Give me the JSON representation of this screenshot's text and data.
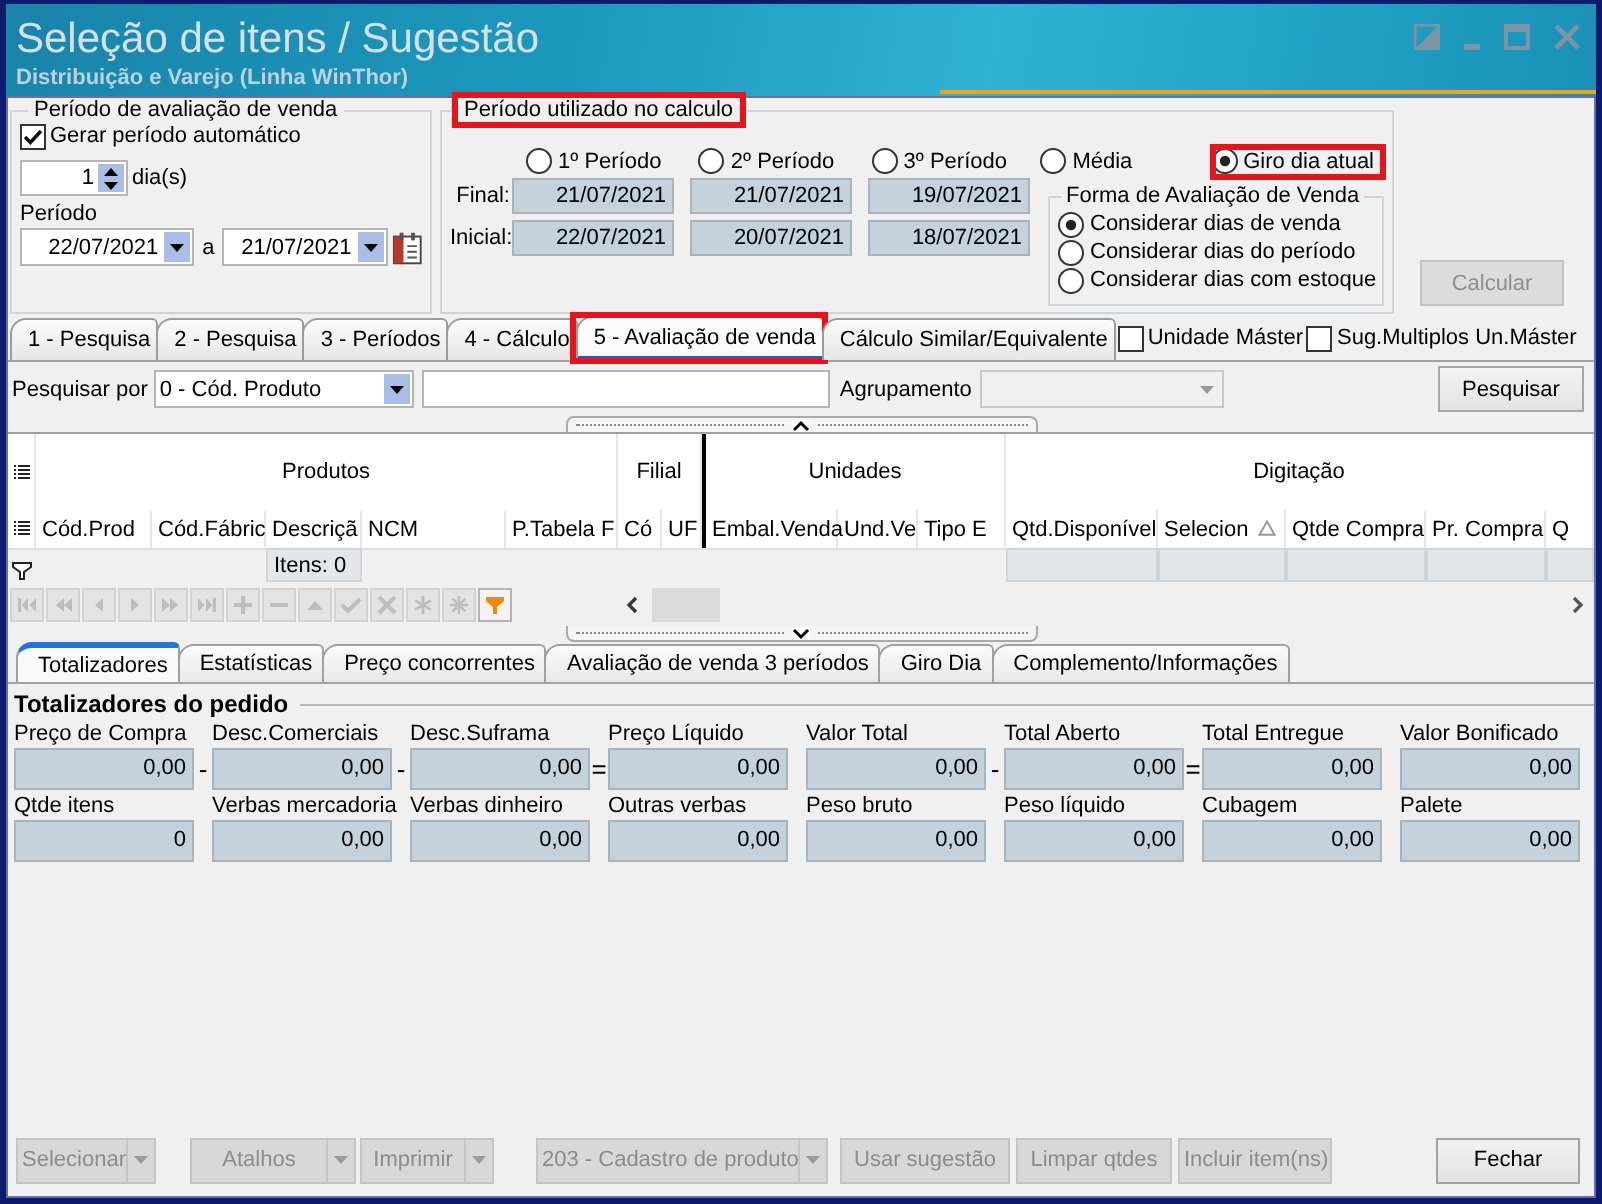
{
  "window": {
    "title": "Seleção de itens / Sugestão",
    "subtitle": "Distribuição e Varejo (Linha WinThor)"
  },
  "sales_period": {
    "title": "Período de avaliação de venda",
    "auto_period": {
      "label": "Gerar período automático",
      "checked": true
    },
    "days": {
      "value": "1",
      "unit": "dia(s)"
    },
    "period_label": "Período",
    "start_date": "22/07/2021",
    "date_separator": "a",
    "end_date": "21/07/2021"
  },
  "calculation_period": {
    "title": "Período utilizado no calculo",
    "highlighted": true,
    "options": [
      {
        "label": "1º Período",
        "selected": false,
        "highlighted": false
      },
      {
        "label": "2º Período",
        "selected": false,
        "highlighted": false
      },
      {
        "label": "3º Período",
        "selected": false,
        "highlighted": false
      },
      {
        "label": "Média",
        "selected": false,
        "highlighted": false
      },
      {
        "label": "Giro dia atual",
        "selected": true,
        "highlighted": true
      }
    ],
    "date_rows": [
      {
        "label": "Final:",
        "dates": [
          "21/07/2021",
          "21/07/2021",
          "19/07/2021"
        ]
      },
      {
        "label": "Inicial:",
        "dates": [
          "22/07/2021",
          "20/07/2021",
          "18/07/2021"
        ]
      }
    ],
    "evaluation_mode": {
      "title": "Forma de Avaliação de Venda",
      "options": [
        {
          "label": "Considerar dias de venda",
          "selected": true
        },
        {
          "label": "Considerar dias do período",
          "selected": false
        },
        {
          "label": "Considerar dias com estoque",
          "selected": false
        }
      ]
    }
  },
  "calculate_button": {
    "label": "Calcular",
    "disabled": true
  },
  "tabs": [
    {
      "label": "1 - Pesquisa",
      "selected": false,
      "highlighted": false
    },
    {
      "label": "2 - Pesquisa",
      "selected": false,
      "highlighted": false
    },
    {
      "label": "3 - Períodos",
      "selected": false,
      "highlighted": false
    },
    {
      "label": "4 - Cálculo",
      "selected": false,
      "highlighted": false
    },
    {
      "label": "5 - Avaliação de venda",
      "selected": true,
      "highlighted": true
    },
    {
      "label": "Cálculo Similar/Equivalente",
      "selected": false,
      "highlighted": false
    }
  ],
  "tab_options": [
    {
      "label": "Unidade Máster",
      "checked": false
    },
    {
      "label": "Sug.Multiplos Un.Máster",
      "checked": false
    }
  ],
  "search": {
    "label": "Pesquisar por",
    "field_value": "0 - Cód. Produto",
    "grouping": {
      "label": "Agrupamento",
      "disabled": true
    },
    "button": "Pesquisar"
  },
  "grid": {
    "groups": [
      {
        "label": "Produtos",
        "columns": [
          {
            "label": "Cód.Prod",
            "sorted": false,
            "summary": false
          },
          {
            "label": "Cód.Fábric",
            "sorted": false,
            "summary": false
          },
          {
            "label": "Descriçã",
            "sorted": false,
            "summary": true,
            "footer": "Itens: 0"
          },
          {
            "label": "NCM",
            "sorted": false,
            "summary": false
          },
          {
            "label": "P.Tabela F",
            "sorted": false,
            "summary": false
          }
        ]
      },
      {
        "label": "Filial",
        "columns": [
          {
            "label": "Có",
            "sorted": false,
            "summary": false
          },
          {
            "label": "UF",
            "sorted": false,
            "summary": false
          }
        ]
      },
      {
        "label": "Unidades",
        "columns": [
          {
            "label": "Embal.Venda",
            "sorted": false,
            "summary": false
          },
          {
            "label": "Und.Ve",
            "sorted": false,
            "summary": false
          },
          {
            "label": "Tipo E",
            "sorted": false,
            "summary": false
          }
        ]
      },
      {
        "label": "Digitação",
        "columns": [
          {
            "label": "Qtd.Disponível",
            "sorted": false,
            "summary": true
          },
          {
            "label": "Selecion",
            "sorted": true,
            "summary": true
          },
          {
            "label": "Qtde Compra",
            "sorted": false,
            "summary": true
          },
          {
            "label": "Pr. Compra",
            "sorted": false,
            "summary": true
          },
          {
            "label": "Q",
            "sorted": false,
            "summary": true
          }
        ]
      }
    ]
  },
  "navigator": {
    "buttons": [
      {
        "kind": "first",
        "disabled": true
      },
      {
        "kind": "prev-page",
        "disabled": true
      },
      {
        "kind": "prev",
        "disabled": true
      },
      {
        "kind": "next",
        "disabled": true
      },
      {
        "kind": "next-page",
        "disabled": true
      },
      {
        "kind": "last",
        "disabled": true
      },
      {
        "kind": "append",
        "disabled": true
      },
      {
        "kind": "delete",
        "disabled": true
      },
      {
        "kind": "edit",
        "disabled": true
      },
      {
        "kind": "post",
        "disabled": true
      },
      {
        "kind": "cancel",
        "disabled": true
      },
      {
        "kind": "refresh",
        "disabled": true
      },
      {
        "kind": "bookmark",
        "disabled": true
      },
      {
        "kind": "filter",
        "disabled": false
      }
    ]
  },
  "bottom_tabs": [
    {
      "label": "Totalizadores",
      "selected": true
    },
    {
      "label": "Estatísticas",
      "selected": false
    },
    {
      "label": "Preço concorrentes",
      "selected": false
    },
    {
      "label": "Avaliação de venda 3 períodos",
      "selected": false
    },
    {
      "label": "Giro Dia",
      "selected": false
    },
    {
      "label": "Complemento/Informações",
      "selected": false
    }
  ],
  "totals": {
    "title": "Totalizadores do pedido",
    "rows": [
      {
        "fields": [
          {
            "label": "Preço de Compra",
            "value": "0,00",
            "operator": "-"
          },
          {
            "label": "Desc.Comerciais",
            "value": "0,00",
            "operator": "-"
          },
          {
            "label": "Desc.Suframa",
            "value": "0,00",
            "operator": "="
          },
          {
            "label": "Preço Líquido",
            "value": "0,00"
          },
          {
            "label": "Valor Total",
            "value": "0,00",
            "operator": "-"
          },
          {
            "label": "Total Aberto",
            "value": "0,00",
            "operator": "="
          },
          {
            "label": "Total Entregue",
            "value": "0,00"
          },
          {
            "label": "Valor Bonificado",
            "value": "0,00"
          }
        ]
      },
      {
        "fields": [
          {
            "label": "Qtde itens",
            "value": "0"
          },
          {
            "label": "Verbas mercadoria",
            "value": "0,00"
          },
          {
            "label": "Verbas dinheiro",
            "value": "0,00"
          },
          {
            "label": "Outras verbas",
            "value": "0,00"
          },
          {
            "label": "Peso bruto",
            "value": "0,00"
          },
          {
            "label": "Peso líquido",
            "value": "0,00"
          },
          {
            "label": "Cubagem",
            "value": "0,00"
          },
          {
            "label": "Palete",
            "value": "0,00"
          }
        ]
      }
    ]
  },
  "actions": [
    {
      "label": "Selecionar",
      "disabled": true,
      "dropdown": true
    },
    {
      "label": "Atalhos",
      "disabled": true,
      "dropdown": true
    },
    {
      "label": "Imprimir",
      "disabled": true,
      "dropdown": true
    },
    {
      "label": "203 - Cadastro de produto",
      "disabled": true,
      "dropdown": true
    },
    {
      "label": "Usar sugestão",
      "disabled": true,
      "dropdown": false
    },
    {
      "label": "Limpar qtdes",
      "disabled": true,
      "dropdown": false
    },
    {
      "label": "Incluir item(ns)",
      "disabled": true,
      "dropdown": false
    },
    {
      "label": "Fechar",
      "disabled": false,
      "dropdown": false
    }
  ]
}
